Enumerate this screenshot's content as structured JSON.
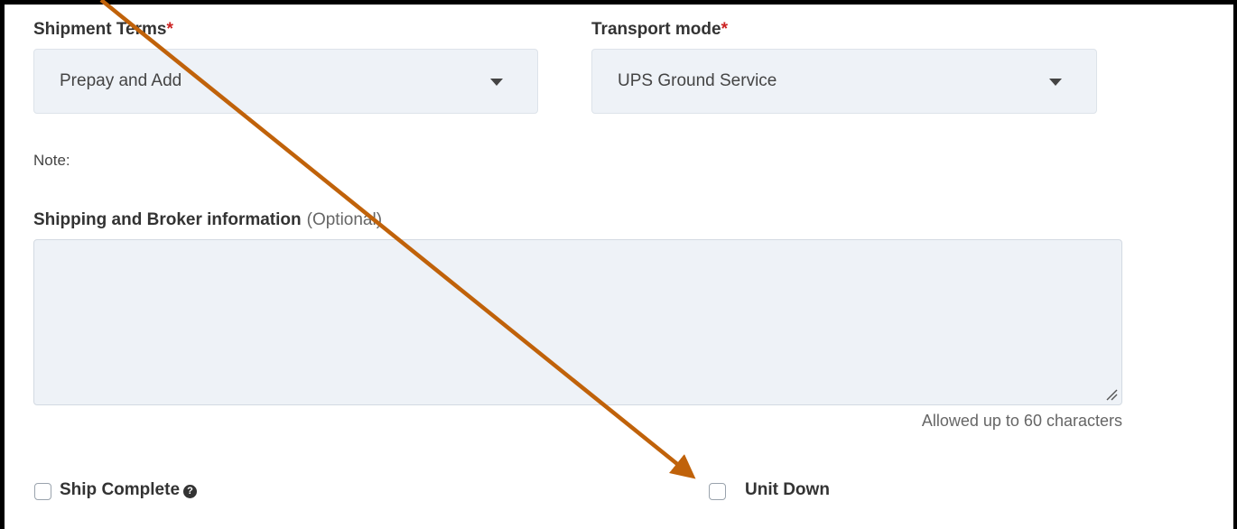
{
  "shipment_terms": {
    "label": "Shipment Terms",
    "required_mark": "*",
    "value": "Prepay and Add"
  },
  "transport_mode": {
    "label": "Transport mode",
    "required_mark": "*",
    "value": "UPS Ground Service"
  },
  "note": {
    "label": "Note:"
  },
  "shipping_broker": {
    "label": "Shipping and Broker information",
    "optional": "(Optional)",
    "value": "",
    "hint": "Allowed up to 60 characters"
  },
  "ship_complete": {
    "label": "Ship Complete",
    "help_icon": "question-circle-icon",
    "checked": false
  },
  "unit_down": {
    "label": "Unit Down",
    "checked": false
  },
  "colors": {
    "field_bg": "#eef2f7",
    "required": "#cc2222",
    "annotation_arrow": "#c0620a"
  }
}
